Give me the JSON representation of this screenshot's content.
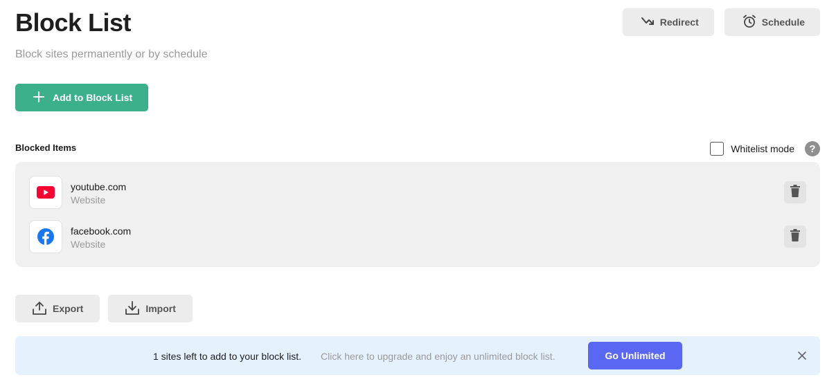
{
  "header": {
    "title": "Block List",
    "subtitle": "Block sites permanently or by schedule"
  },
  "top_buttons": {
    "redirect_label": "Redirect",
    "schedule_label": "Schedule"
  },
  "add_button_label": "Add to Block List",
  "section_label": "Blocked Items",
  "whitelist": {
    "label": "Whitelist mode",
    "checked": false,
    "help_glyph": "?"
  },
  "items": [
    {
      "name": "youtube.com",
      "type": "Website",
      "icon": "youtube-icon"
    },
    {
      "name": "facebook.com",
      "type": "Website",
      "icon": "facebook-icon"
    }
  ],
  "io": {
    "export_label": "Export",
    "import_label": "Import"
  },
  "banner": {
    "main_text": "1 sites left to add to your block list.",
    "sub_text": "Click here to upgrade and enjoy an unlimited block list.",
    "cta_label": "Go Unlimited",
    "close_glyph": "×"
  },
  "colors": {
    "accent_green": "#3bb08a",
    "cta_blue": "#5a67f2",
    "banner_bg": "#e5f1fc",
    "youtube_red": "#ff0033",
    "facebook_blue": "#1877f2"
  }
}
